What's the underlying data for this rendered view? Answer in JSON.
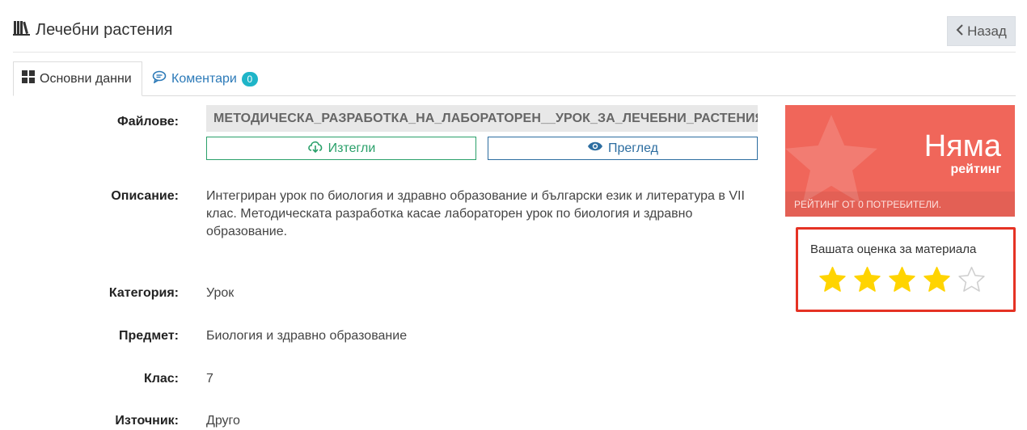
{
  "header": {
    "title": "Лечебни растения",
    "title_icon": "library-books-icon",
    "back_label": "Назад"
  },
  "tabs": [
    {
      "label": "Основни данни",
      "icon": "grid-icon"
    },
    {
      "label": "Коментари",
      "icon": "comment-icon",
      "count": "0"
    }
  ],
  "files": {
    "label": "Файлове:",
    "file_name": "МЕТОДИЧЕСКА_РАЗРАБОТКА_НА_ЛАБОРАТОРЕН__УРОК_ЗА_ЛЕЧЕБНИ_РАСТЕНИЯ.PDF",
    "download_label": "Изтегли",
    "preview_label": "Преглед"
  },
  "description": {
    "label": "Описание:",
    "text": "Интегриран урок по биология и здравно образование и български език и литература в VII клас. Методическата разработка касае лабораторен урок по биология и здравно образование."
  },
  "category": {
    "label": "Категория:",
    "value": "Урок"
  },
  "subject": {
    "label": "Предмет:",
    "value": "Биология и здравно образование"
  },
  "grade": {
    "label": "Клас:",
    "value": "7"
  },
  "source": {
    "label": "Източник:",
    "value": "Друго"
  },
  "rating": {
    "big": "Няма",
    "sub": "рейтинг",
    "footer": "РЕЙТИНГ ОТ 0 ПОТРЕБИТЕЛИ.",
    "color": "#f0665a"
  },
  "vote": {
    "title": "Вашата оценка за материала",
    "selected": 4,
    "max": 5,
    "filled_color": "#ffd400",
    "empty_color": "#cfcfcf"
  }
}
